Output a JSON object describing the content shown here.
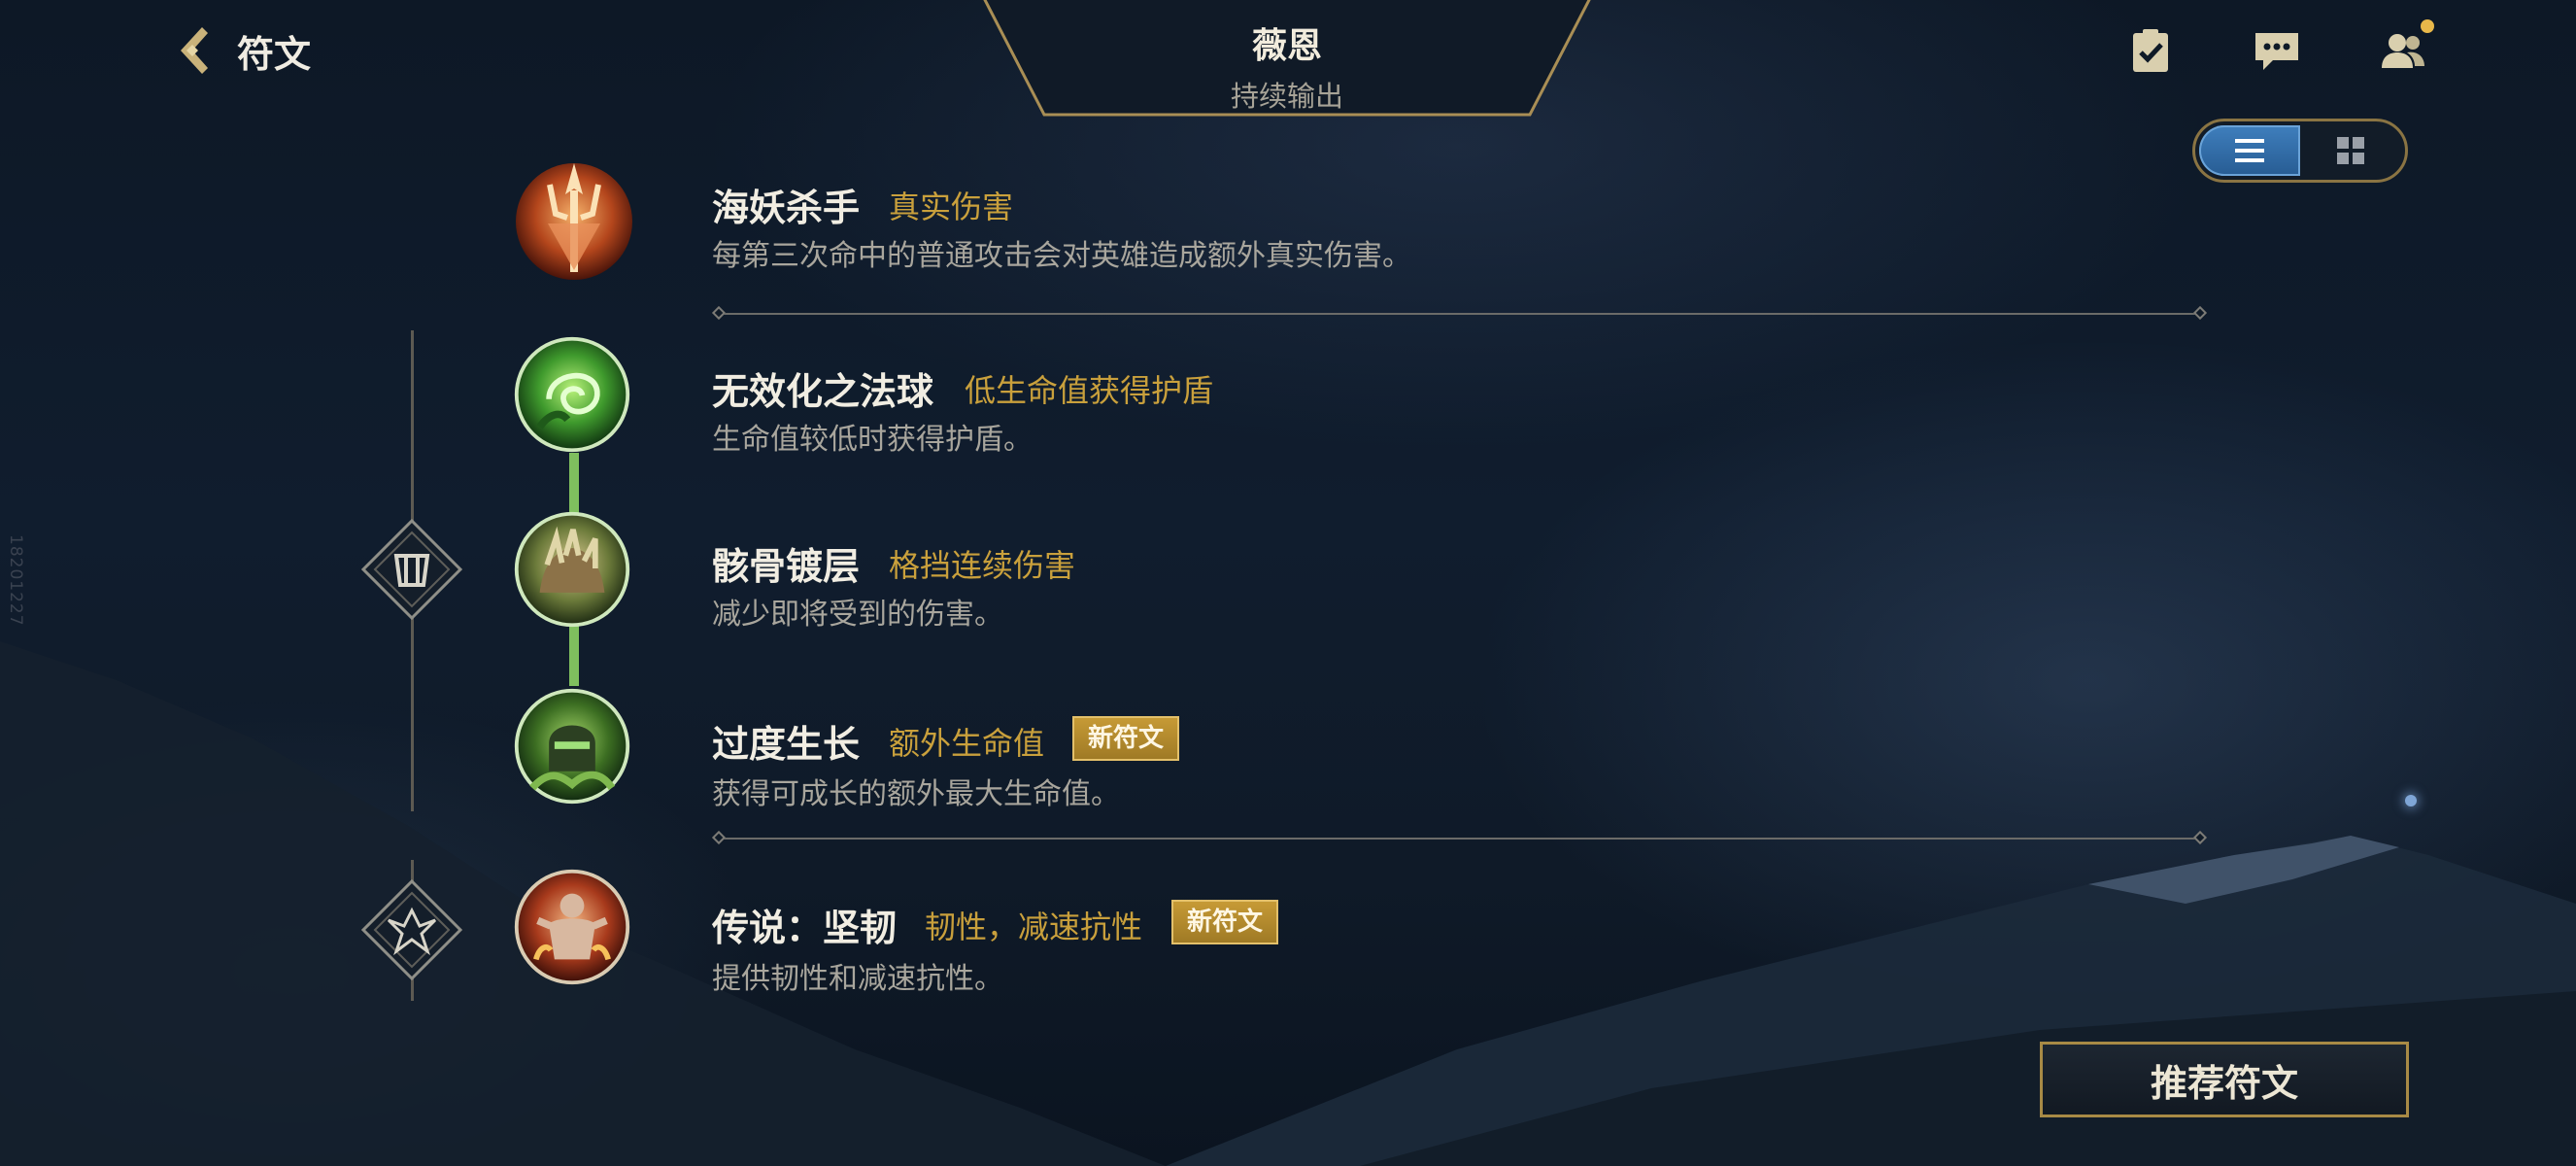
{
  "header": {
    "title": "符文",
    "hero_name": "薇恩",
    "hero_role": "持续输出"
  },
  "top_icons": [
    {
      "name": "task-clipboard-icon"
    },
    {
      "name": "chat-icon"
    },
    {
      "name": "friends-icon",
      "notification": true
    }
  ],
  "view_toggle": {
    "active": "list"
  },
  "runes": [
    {
      "name": "海妖杀手",
      "tag": "真实伤害",
      "desc": "每第三次命中的普通攻击会对英雄造成额外真实伤害。",
      "icon": "trident-icon",
      "new": false
    },
    {
      "name": "无效化之法球",
      "tag": "低生命值获得护盾",
      "desc": "生命值较低时获得护盾。",
      "icon": "green-orb-icon",
      "new": false
    },
    {
      "name": "骸骨镀层",
      "tag": "格挡连续伤害",
      "desc": "减少即将受到的伤害。",
      "icon": "bone-plating-icon",
      "new": false
    },
    {
      "name": "过度生长",
      "tag": "额外生命值",
      "desc": "获得可成长的额外最大生命值。",
      "icon": "overgrowth-icon",
      "new": true
    },
    {
      "name": "传说：坚韧",
      "tag": "韧性，减速抗性",
      "desc": "提供韧性和减速抗性。",
      "icon": "legend-tenacity-icon",
      "new": true
    }
  ],
  "new_badge_label": "新符文",
  "recommend_button": "推荐符文",
  "side_code": "18201227",
  "colors": {
    "accent_gold": "#c9a03c",
    "frame_gold": "#a88a45",
    "toggle_blue": "#3f7fbd",
    "connector_green": "#7fbf5e"
  }
}
